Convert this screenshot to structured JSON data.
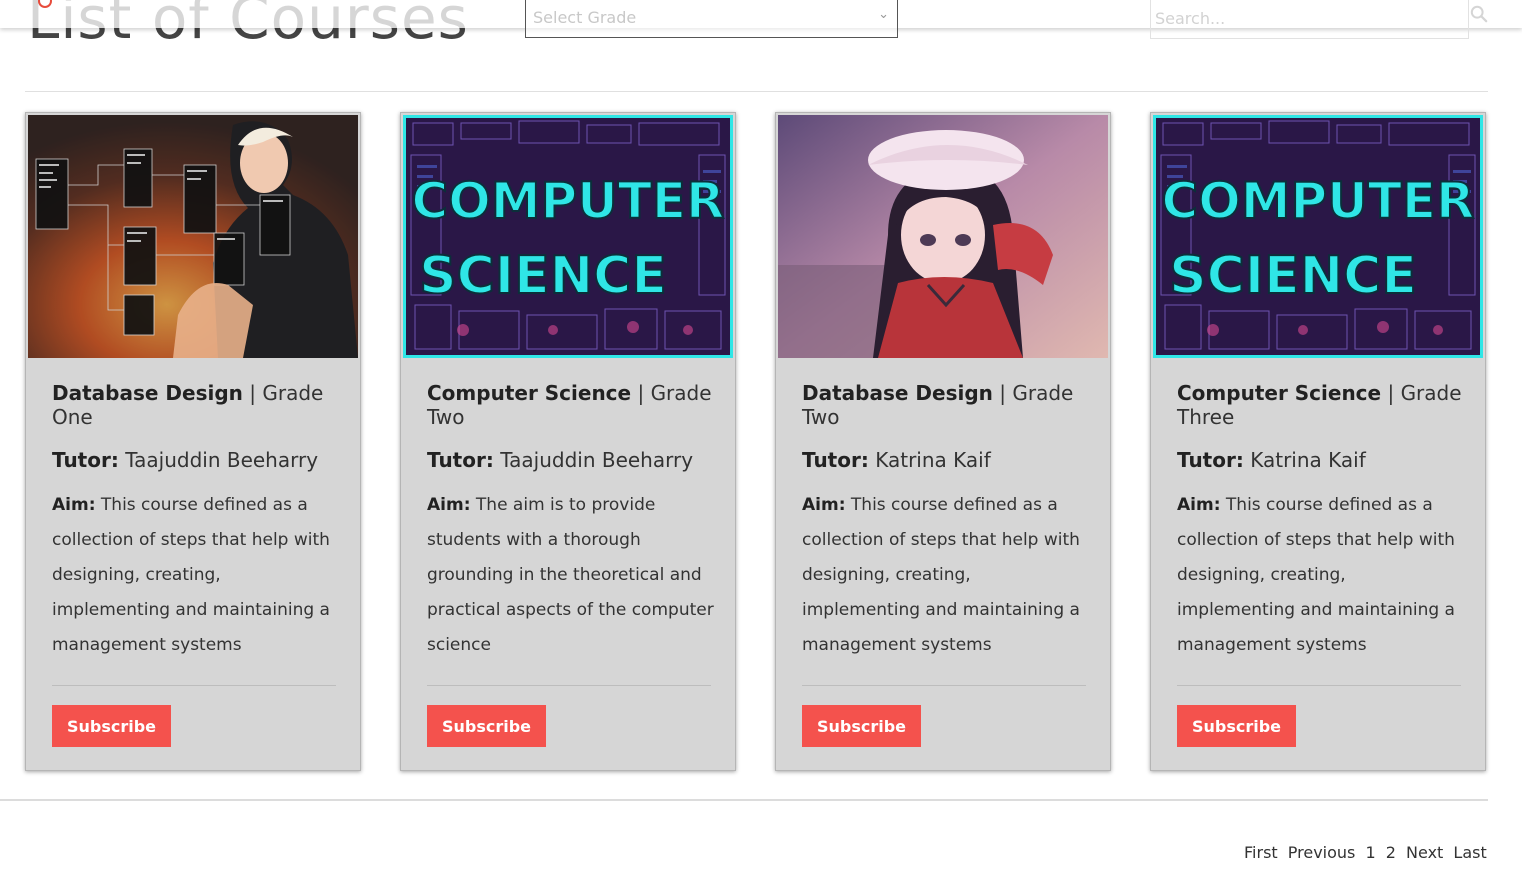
{
  "page": {
    "heading": "List of Courses"
  },
  "filters": {
    "grade_placeholder": "Select Grade",
    "search_placeholder": "Search..."
  },
  "labels": {
    "tutor": "Tutor:",
    "aim": "Aim:",
    "subscribe": "Subscribe"
  },
  "courses": [
    {
      "name": "Database Design",
      "grade_suffix": " | Grade One",
      "tutor": "Taajuddin Beeharry",
      "aim": "This course defined as a collection of steps that help with designing, creating, implementing and maintaining a management systems",
      "image": "database-design-photo"
    },
    {
      "name": "Computer Science",
      "grade_suffix": " | Grade Two",
      "tutor": "Taajuddin Beeharry",
      "aim": "The aim is to provide students with a thorough grounding in the theoretical and practical aspects of the computer science",
      "image": "computer-science-banner",
      "image_text": [
        "COMPUTER",
        "SCIENCE"
      ]
    },
    {
      "name": "Database Design",
      "grade_suffix": " | Grade Two",
      "tutor": "Katrina Kaif",
      "aim": "This course defined as a collection of steps that help with designing, creating, implementing and maintaining a management systems",
      "image": "anime-illustration"
    },
    {
      "name": "Computer Science",
      "grade_suffix": " | Grade Three",
      "tutor": "Katrina Kaif",
      "aim": "This course defined as a collection of steps that help with designing, creating, implementing and maintaining a management systems",
      "image": "computer-science-banner",
      "image_text": [
        "COMPUTER",
        "SCIENCE"
      ]
    }
  ],
  "pagination": {
    "first": "First",
    "previous": "Previous",
    "pages": [
      "1",
      "2"
    ],
    "next": "Next",
    "last": "Last"
  },
  "colors": {
    "accent": "#f4524d",
    "card_bg": "#d6d6d6",
    "banner_text": "#2fe6e6"
  }
}
